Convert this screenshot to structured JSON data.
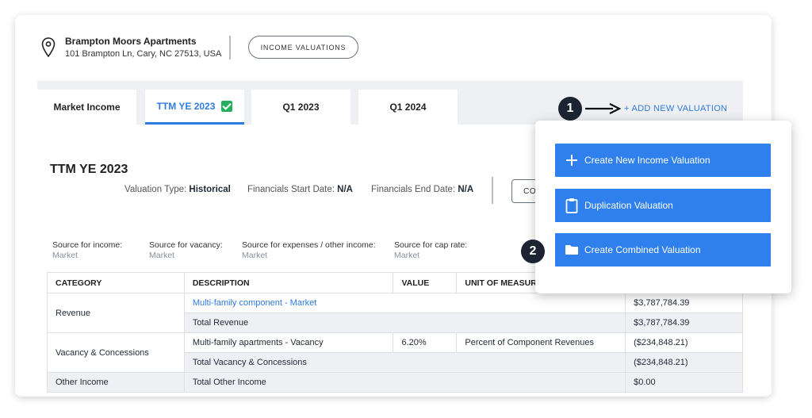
{
  "property": {
    "name": "Brampton Moors Apartments",
    "address": "101 Brampton Ln, Cary, NC 27513, USA",
    "income_valuations_label": "INCOME VALUATIONS"
  },
  "tabs": [
    {
      "label": "Market Income"
    },
    {
      "label": "TTM YE 2023",
      "active": true,
      "checked": true
    },
    {
      "label": "Q1 2023"
    },
    {
      "label": "Q1 2024"
    }
  ],
  "add_new_valuation_label": "+ ADD NEW VALUATION",
  "section": {
    "title": "TTM YE 2023",
    "valuation_type_label": "Valuation Type:",
    "valuation_type_value": "Historical",
    "start_label": "Financials Start Date:",
    "start_value": "N/A",
    "end_label": "Financials End Date:",
    "end_value": "N/A",
    "partial_button_label": "CO"
  },
  "sources": [
    {
      "label": "Source for income:",
      "value": "Market"
    },
    {
      "label": "Source for vacancy:",
      "value": "Market"
    },
    {
      "label": "Source for expenses / other income:",
      "value": "Market"
    },
    {
      "label": "Source for cap rate:",
      "value": "Market"
    }
  ],
  "table": {
    "headers": {
      "category": "CATEGORY",
      "description": "DESCRIPTION",
      "value": "VALUE",
      "unit": "UNIT OF MEASUR"
    },
    "rows": {
      "revenue_category": "Revenue",
      "revenue_desc": "Multi-family component - Market",
      "revenue_amount": "$3,787,784.39",
      "total_revenue_desc": "Total Revenue",
      "total_revenue_amount": "$3,787,784.39",
      "vacancy_category": "Vacancy & Concessions",
      "vacancy_desc": "Multi-family apartments - Vacancy",
      "vacancy_value": "6.20%",
      "vacancy_unit": "Percent of Component Revenues",
      "vacancy_amount": "($234,848.21)",
      "total_vacancy_desc": "Total Vacancy & Concessions",
      "total_vacancy_amount": "($234,848.21)",
      "other_category": "Other Income",
      "other_desc": "Total Other Income",
      "other_amount": "$0.00"
    }
  },
  "popup": {
    "create_new": "Create New Income Valuation",
    "duplication": "Duplication Valuation",
    "create_combined": "Create Combined Valuation"
  },
  "steps": {
    "one": "1",
    "two": "2"
  },
  "colors": {
    "accent": "#2f80ed",
    "link": "#2f7be0",
    "check": "#22b05c",
    "step_badge": "#1b2430"
  }
}
